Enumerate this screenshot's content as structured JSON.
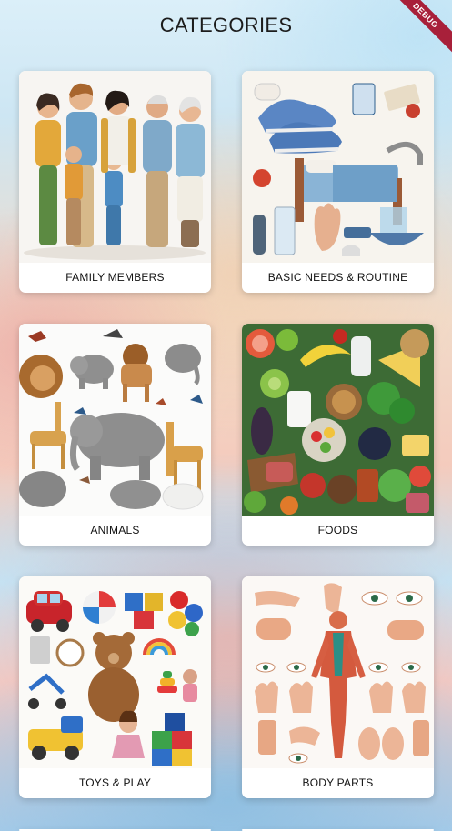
{
  "header": {
    "title": "CATEGORIES"
  },
  "debug_banner": "DEBUG",
  "categories": [
    {
      "label": "FAMILY MEMBERS",
      "icon": "family-illustration"
    },
    {
      "label": "BASIC NEEDS & ROUTINE",
      "icon": "routine-items-illustration"
    },
    {
      "label": "ANIMALS",
      "icon": "wild-animals-illustration"
    },
    {
      "label": "FOODS",
      "icon": "assorted-foods-illustration"
    },
    {
      "label": "TOYS & PLAY",
      "icon": "toys-illustration"
    },
    {
      "label": "BODY PARTS",
      "icon": "body-parts-illustration"
    }
  ]
}
